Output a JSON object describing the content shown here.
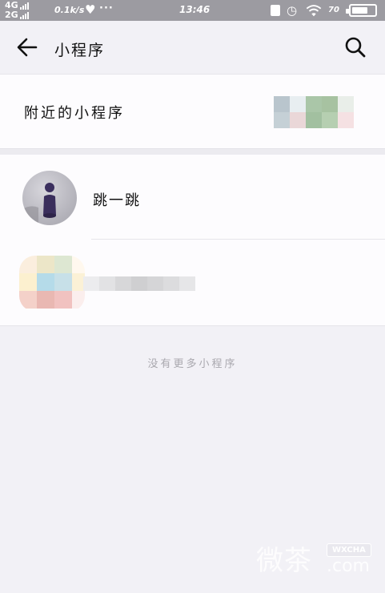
{
  "status_bar": {
    "network_top": "4G",
    "network_bottom": "2G",
    "speed": "0.1k/s",
    "more": "···",
    "time": "13:46",
    "battery_percent": "70",
    "battery_level": 0.7
  },
  "navbar": {
    "title": "小程序",
    "back_icon": "arrow-left-icon",
    "search_icon": "search-icon"
  },
  "nearby": {
    "label": "附近的小程序"
  },
  "list": {
    "items": [
      {
        "name": "跳一跳"
      }
    ]
  },
  "footer": {
    "no_more": "没有更多小程序"
  },
  "watermark": {
    "chars": "微茶",
    "badge": "WXCHA",
    "domain": ".com"
  },
  "colors": {
    "status_bar": "#9c9ba1",
    "background": "#f2f1f6",
    "card": "#fdfcfe",
    "secondary_text": "#a9a8ae"
  }
}
